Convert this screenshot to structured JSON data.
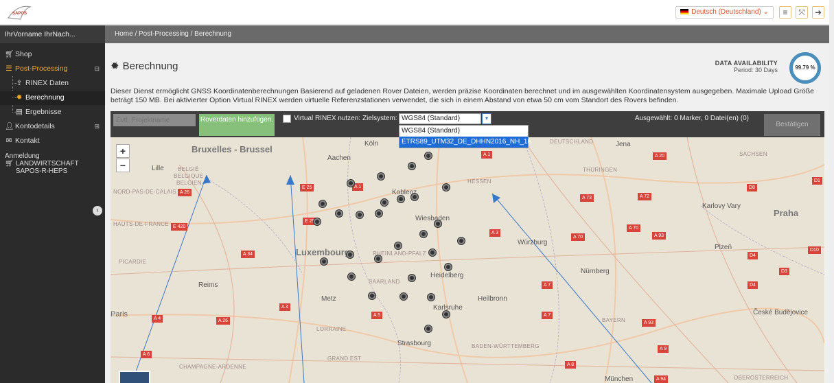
{
  "topbar": {
    "logo_text": "SAPOS",
    "language": "Deutsch (Deutschland)",
    "icons": [
      "menu-icon",
      "fullscreen-icon",
      "logout-icon"
    ]
  },
  "sidebar": {
    "username": "IhrVorname IhrNach...",
    "items": [
      {
        "label": "Shop",
        "icon": "cart-icon"
      },
      {
        "label": "Post-Processing",
        "icon": "database-icon",
        "right": "⊟"
      },
      {
        "label": "Kontodetails",
        "icon": "user-icon",
        "right": "⊞"
      },
      {
        "label": "Kontakt",
        "icon": "mail-icon"
      }
    ],
    "subitems": [
      {
        "label": "RINEX Daten",
        "icon": "upload-icon"
      },
      {
        "label": "Berechnung",
        "icon": "gear-icon"
      },
      {
        "label": "Ergebnisse",
        "icon": "table-icon"
      }
    ],
    "anmeldung": "Anmeldung",
    "landwirtschaft": "LANDWIRTSCHAFT SAPOS-R-HEPS"
  },
  "breadcrumb": "Home / Post-Processing / Berechnung",
  "page": {
    "title": "Berechnung",
    "data_availability_label": "DATA AVAILABILITY",
    "data_availability_period": "Period: 30 Days",
    "data_availability_value": "99.79 %",
    "description": "Dieser Dienst ermöglicht GNSS Koordinatenberechnungen Basierend auf geladenen Rover Dateien, werden präzise Koordinaten berechnet und im ausgewählten Koordinatensystem ausgegeben. Maximale Upload Größe beträgt 150 MB. Bei aktivierter Option Virtual RINEX werden virtuelle Referenzstationen verwendet, die sich in einem Abstand von etwa 50 cm vom Standort des Rovers befinden."
  },
  "toolbar": {
    "project_placeholder": "Evtl. Projektname",
    "rover_button": "Roverdaten hinzufügen.",
    "virtual_rinex_label": "Virtual RINEX nutzen:",
    "zielsystem_label": "Zielsystem:",
    "zielsystem_value": "WGS84 (Standard)",
    "zielsystem_options": [
      "WGS84 (Standard)",
      "ETRS89_UTM32_DE_DHHN2016_NH_16"
    ],
    "selection_info": "Ausgewählt:  0 Marker, 0 Datei(en) (0)",
    "confirm_button": "Bestätigen"
  },
  "map": {
    "zoom_in": "+",
    "zoom_out": "−",
    "cities": {
      "brussel": "Bruxelles - Brussel",
      "luxembourg": "Luxembourg",
      "paris": "Paris",
      "koeln": "Köln",
      "aachen": "Aachen",
      "koblenz": "Koblenz",
      "wiesbaden": "Wiesbaden",
      "wuerzburg": "Würzburg",
      "heidelberg": "Heidelberg",
      "karlsruhe": "Karlsruhe",
      "heilbronn": "Heilbronn",
      "nuernberg": "Nürnberg",
      "strasbourg": "Strasbourg",
      "metz": "Metz",
      "reims": "Reims",
      "lille": "Lille",
      "jena": "Jena",
      "praha": "Praha",
      "karlovy": "Karlovy Vary",
      "plzen": "Plzeň",
      "budejovice": "České Budějovice",
      "muenchen": "München"
    },
    "regions": {
      "belgie": "BELGIË",
      "belgique": "BELGIQUE",
      "belgien": "BELGIEN",
      "nord": "NORD-PAS-DE-CALAIS",
      "hauts": "HAUTS-DE-FRANCE",
      "picardie": "PICARDIE",
      "hessen": "HESSEN",
      "thueringen": "THÜRINGEN",
      "rheinland": "RHEINLAND-PFALZ",
      "saarland": "SAARLAND",
      "lorraine": "LORRAINE",
      "grand_est": "GRAND EST",
      "champagne": "CHAMPAGNE-ARDENNE",
      "bayern": "BAYERN",
      "bw": "BADEN-WÜRTTEMBERG",
      "deutschland": "DEUTSCHLAND",
      "sachsen": "SACHSEN",
      "oberoesterreich": "OBERÖSTERREICH"
    },
    "shields": [
      "A 1",
      "A 1",
      "A 3",
      "A 4",
      "A 4",
      "A 5",
      "A 6",
      "A 7",
      "A 7",
      "A 8",
      "A 9",
      "A 20",
      "A 26",
      "A 26",
      "A 34",
      "A 70",
      "A 70",
      "A 72",
      "A 73",
      "A 93",
      "A 93",
      "A 94",
      "E 25",
      "E 25",
      "E 420",
      "D1",
      "D3",
      "D4",
      "D4",
      "D8",
      "D10"
    ]
  }
}
